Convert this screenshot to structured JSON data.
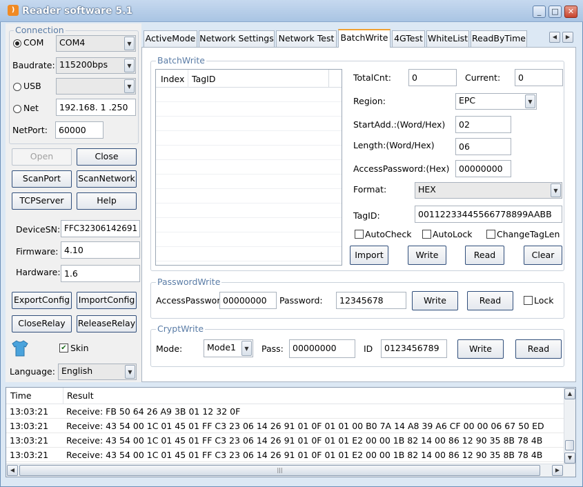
{
  "window": {
    "title": "Reader software 5.1",
    "min": "_",
    "max": "□",
    "close": "✕"
  },
  "connection": {
    "group_title": "Connection",
    "com_label": "COM",
    "com_value": "COM4",
    "baudrate_label": "Baudrate:",
    "baudrate_value": "115200bps",
    "usb_label": "USB",
    "usb_value": "",
    "net_label": "Net",
    "net_value": "192.168. 1 .250",
    "netport_label": "NetPort:",
    "netport_value": "60000",
    "selected": "COM"
  },
  "buttons_left": {
    "open": "Open",
    "close": "Close",
    "scanport": "ScanPort",
    "scannetwork": "ScanNetwork",
    "tcpserver": "TCPServer",
    "help": "Help",
    "exportconfig": "ExportConfig",
    "importconfig": "ImportConfig",
    "closerelay": "CloseRelay",
    "releaserelay": "ReleaseRelay"
  },
  "device": {
    "sn_label": "DeviceSN:",
    "sn_value": "FFC32306142691",
    "fw_label": "Firmware:",
    "fw_value": "4.10",
    "hw_label": "Hardware:",
    "hw_value": "1.6"
  },
  "skin": {
    "label": "Skin",
    "checked": true
  },
  "language": {
    "label": "Language:",
    "value": "English"
  },
  "tabs": [
    "ActiveMode",
    "Network Settings",
    "Network Test",
    "BatchWrite",
    "4GTest",
    "WhiteList",
    "ReadByTime"
  ],
  "active_tab": "BatchWrite",
  "batchwrite": {
    "group_title": "BatchWrite",
    "col_index": "Index",
    "col_tagid": "TagID",
    "totalcnt_label": "TotalCnt:",
    "totalcnt_value": "0",
    "current_label": "Current:",
    "current_value": "0",
    "region_label": "Region:",
    "region_value": "EPC",
    "startadd_label": "StartAdd.:(Word/Hex)",
    "startadd_value": "02",
    "length_label": "Length:(Word/Hex)",
    "length_value": "06",
    "accesspw_label": "AccessPassword:(Hex)",
    "accesspw_value": "00000000",
    "format_label": "Format:",
    "format_value": "HEX",
    "tagid_label": "TagID:",
    "tagid_value": "00112233445566778899AABB",
    "autocheck": "AutoCheck",
    "autolock": "AutoLock",
    "changetaglen": "ChangeTagLen",
    "import": "Import",
    "write": "Write",
    "read": "Read",
    "clear": "Clear"
  },
  "passwordwrite": {
    "group_title": "PasswordWrite",
    "access_label": "AccessPasswor",
    "access_value": "00000000",
    "password_label": "Password:",
    "password_value": "12345678",
    "write": "Write",
    "read": "Read",
    "lock": "Lock"
  },
  "cryptwrite": {
    "group_title": "CryptWrite",
    "mode_label": "Mode:",
    "mode_value": "Mode1",
    "pass_label": "Pass:",
    "pass_value": "00000000",
    "id_label": "ID",
    "id_value": "0123456789",
    "write": "Write",
    "read": "Read"
  },
  "log": {
    "col_time": "Time",
    "col_result": "Result",
    "rows": [
      {
        "time": "13:03:21",
        "result": "Receive: FB 50 64 26 A9 3B 01 12 32 0F"
      },
      {
        "time": "13:03:21",
        "result": "Receive: 43 54 00 1C 01 45 01 FF C3 23 06 14 26 91 01 0F 01 01 00 B0 7A 14 A8 39 A6 CF 00 00 06 67 50 ED"
      },
      {
        "time": "13:03:21",
        "result": "Receive: 43 54 00 1C 01 45 01 FF C3 23 06 14 26 91 01 0F 01 01 E2 00 00 1B 82 14 00 86 12 90 35 8B 78 4B"
      },
      {
        "time": "13:03:21",
        "result": "Receive: 43 54 00 1C 01 45 01 FF C3 23 06 14 26 91 01 0F 01 01 E2 00 00 1B 82 14 00 86 12 90 35 8B 78 4B"
      }
    ]
  }
}
